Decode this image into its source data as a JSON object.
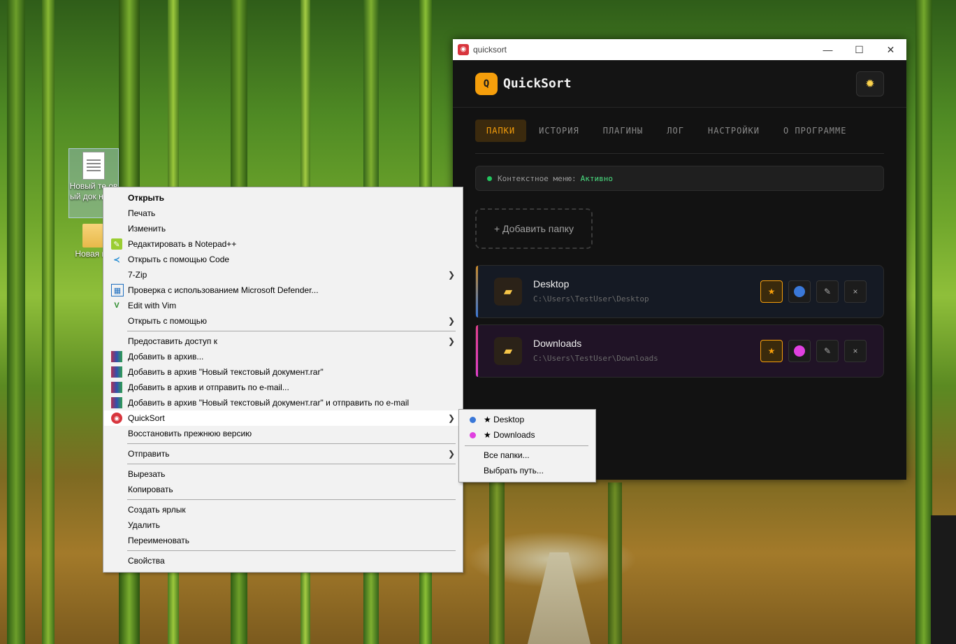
{
  "desktop": {
    "icons": [
      {
        "label": "Новый те овый док нт.txt"
      },
      {
        "label": "Новая па"
      }
    ]
  },
  "app": {
    "window_title": "quicksort",
    "window_controls": {
      "minimize": "—",
      "maximize": "☐",
      "close": "✕"
    },
    "logo_letter": "Q",
    "name": "QuickSort",
    "theme_icon": "sun-icon",
    "tabs": [
      {
        "label": "ПАПКИ",
        "active": true
      },
      {
        "label": "ИСТОРИЯ",
        "active": false
      },
      {
        "label": "ПЛАГИНЫ",
        "active": false
      },
      {
        "label": "ЛОГ",
        "active": false
      },
      {
        "label": "НАСТРОЙКИ",
        "active": false
      },
      {
        "label": "О ПРОГРАММЕ",
        "active": false
      }
    ],
    "status": {
      "label": "Контекстное меню:",
      "value": "Активно"
    },
    "add_folder_label": "+ Добавить папку",
    "folders": [
      {
        "name": "Desktop",
        "path": "C:\\Users\\TestUser\\Desktop",
        "color": "#3a78d8",
        "accent": "#c98a2a",
        "bg": "#151a24"
      },
      {
        "name": "Downloads",
        "path": "C:\\Users\\TestUser\\Downloads",
        "color": "#e040e0",
        "accent": "#e040c8",
        "bg": "#201326"
      }
    ],
    "card_action_icons": {
      "star": "★",
      "edit": "✎",
      "remove": "×"
    }
  },
  "context_menu": {
    "items": [
      {
        "label": "Открыть",
        "bold": true
      },
      {
        "label": "Печать"
      },
      {
        "label": "Изменить"
      },
      {
        "label": "Редактировать в Notepad++",
        "icon": "notepad-plus-plus-icon"
      },
      {
        "label": "Открыть с помощью Code",
        "icon": "vscode-icon"
      },
      {
        "label": "7-Zip",
        "submenu": true
      },
      {
        "label": "Проверка с использованием Microsoft Defender...",
        "icon": "defender-icon"
      },
      {
        "label": "Edit with Vim",
        "icon": "vim-icon"
      },
      {
        "label": "Открыть с помощью",
        "submenu": true
      },
      {
        "label": "Предоставить доступ к",
        "submenu": true
      },
      {
        "label": "Добавить в архив...",
        "icon": "winrar-icon"
      },
      {
        "label": "Добавить в архив \"Новый текстовый документ.rar\"",
        "icon": "winrar-icon"
      },
      {
        "label": "Добавить в архив и отправить по e-mail...",
        "icon": "winrar-icon"
      },
      {
        "label": "Добавить в архив \"Новый текстовый документ.rar\" и отправить по e-mail",
        "icon": "winrar-icon"
      },
      {
        "label": "QuickSort",
        "submenu": true,
        "icon": "quicksort-icon",
        "highlight": true
      },
      {
        "label": "Восстановить прежнюю версию"
      },
      {
        "label": "Отправить",
        "submenu": true
      },
      {
        "label": "Вырезать"
      },
      {
        "label": "Копировать"
      },
      {
        "label": "Создать ярлык"
      },
      {
        "label": "Удалить"
      },
      {
        "label": "Переименовать"
      },
      {
        "label": "Свойства"
      }
    ],
    "submenu_arrow": "❯"
  },
  "quicksort_submenu": {
    "items": [
      {
        "label": "★ Desktop",
        "color": "#3a78d8"
      },
      {
        "label": "★ Downloads",
        "color": "#e040e0"
      },
      {
        "label": "Все папки..."
      },
      {
        "label": "Выбрать путь..."
      }
    ]
  }
}
